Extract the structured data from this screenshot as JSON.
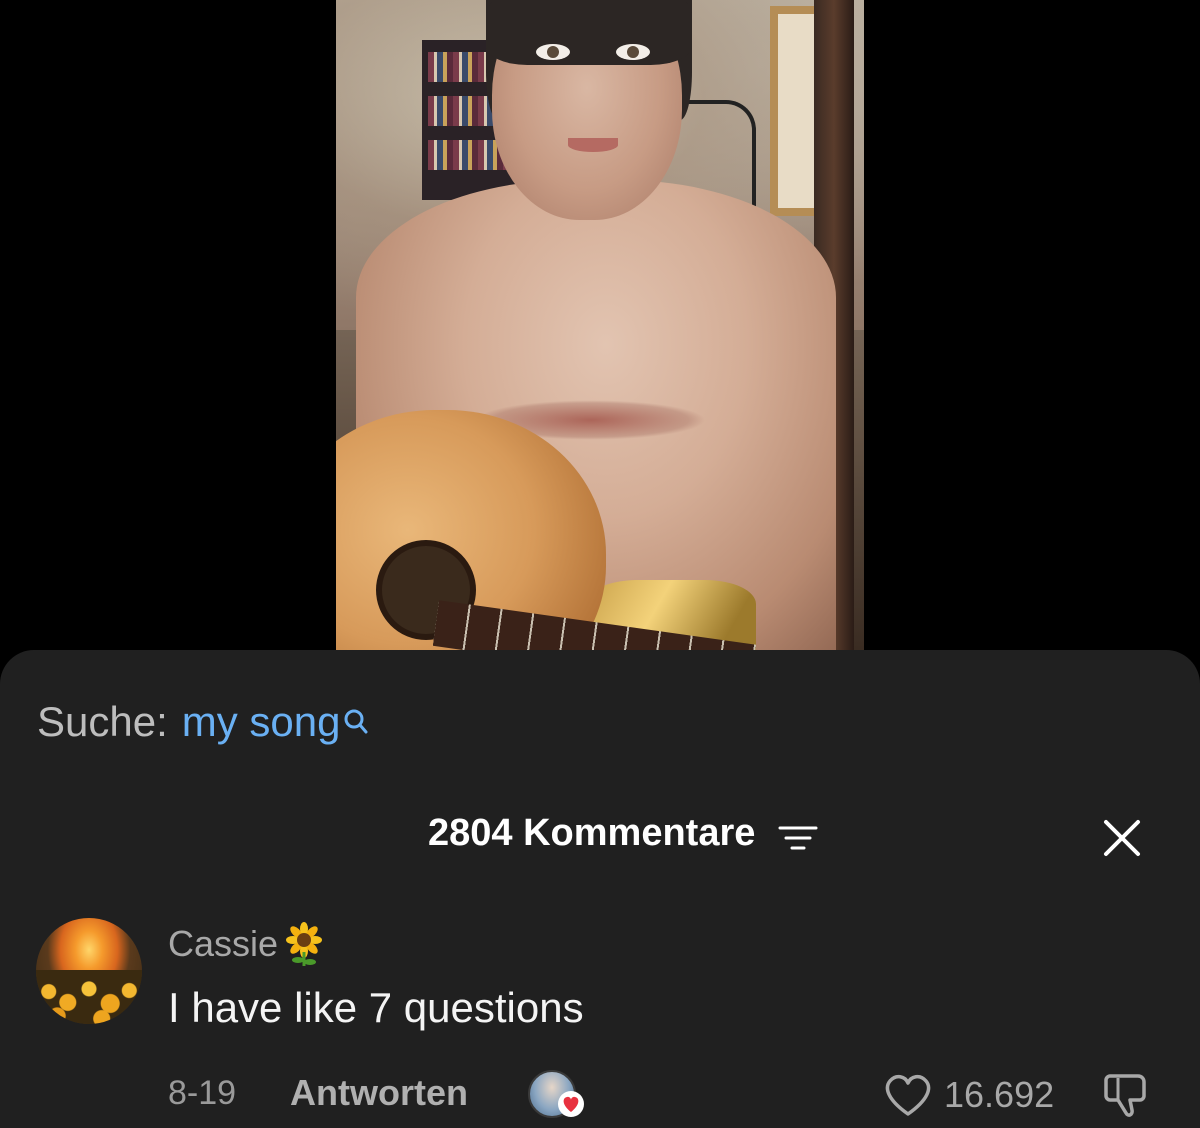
{
  "video": {
    "description_icon": "video-frame"
  },
  "search": {
    "prefix": "Suche:",
    "term": "my song",
    "icon": "search-icon"
  },
  "comments_header": {
    "count_label": "2804 Kommentare",
    "sort_icon": "sort-icon",
    "close_icon": "close-icon"
  },
  "comment": {
    "username": "Cassie",
    "username_emoji": "sunflower",
    "text": "I have like 7 questions",
    "date": "8-19",
    "reply_label": "Antworten",
    "creator_liked": true,
    "like_count": "16.692"
  },
  "colors": {
    "sheet_background": "#202020",
    "search_term": "#6ab0f3",
    "muted_text": "#a8a8a8",
    "heart_badge": "#e8313f"
  }
}
